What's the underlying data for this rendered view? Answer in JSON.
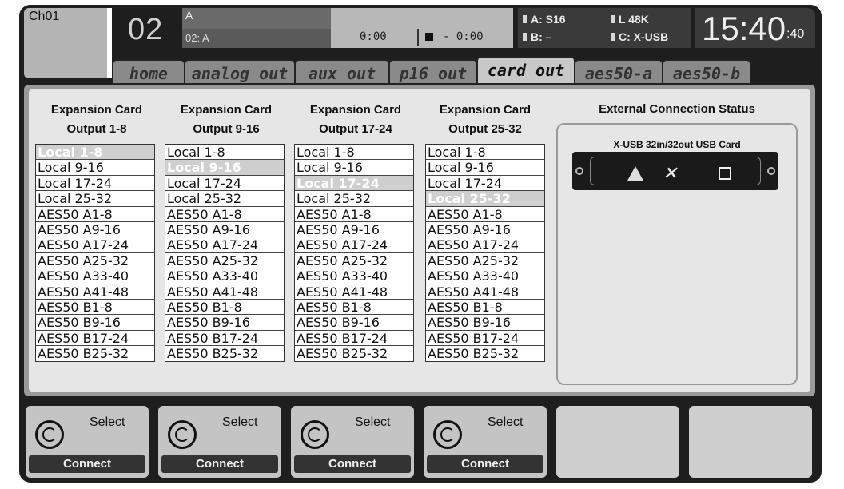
{
  "channel": {
    "label": "Ch01",
    "number": "02"
  },
  "name": {
    "top": "A",
    "bottom": "02: A"
  },
  "transport": {
    "elapsed": "0:00",
    "remaining": "- 0:00"
  },
  "status": {
    "a": "A: S16",
    "b": "B:  –",
    "l": "L  48K",
    "c": "C: X-USB"
  },
  "clock": {
    "time": "15:40",
    "seconds": ":40"
  },
  "tabs": [
    {
      "label": "home"
    },
    {
      "label": "analog out"
    },
    {
      "label": "aux out"
    },
    {
      "label": "p16 out"
    },
    {
      "label": "card out"
    },
    {
      "label": "aes50-a"
    },
    {
      "label": "aes50-b"
    }
  ],
  "columns": [
    {
      "title1": "Expansion Card",
      "title2": "Output 1-8"
    },
    {
      "title1": "Expansion Card",
      "title2": "Output 9-16"
    },
    {
      "title1": "Expansion Card",
      "title2": "Output 17-24"
    },
    {
      "title1": "Expansion Card",
      "title2": "Output 25-32"
    }
  ],
  "options": [
    "Local 1-8",
    "Local 9-16",
    "Local 17-24",
    "Local 25-32",
    "AES50 A1-8",
    "AES50 A9-16",
    "AES50 A17-24",
    "AES50 A25-32",
    "AES50 A33-40",
    "AES50 A41-48",
    "AES50 B1-8",
    "AES50 B9-16",
    "AES50 B17-24",
    "AES50 B25-32"
  ],
  "selected": [
    0,
    1,
    2,
    3
  ],
  "external": {
    "title": "External Connection Status",
    "card": "X-USB  32in/32out USB Card"
  },
  "buttons": [
    {
      "select": "Select",
      "connect": "Connect"
    },
    {
      "select": "Select",
      "connect": "Connect"
    },
    {
      "select": "Select",
      "connect": "Connect"
    },
    {
      "select": "Select",
      "connect": "Connect"
    }
  ]
}
